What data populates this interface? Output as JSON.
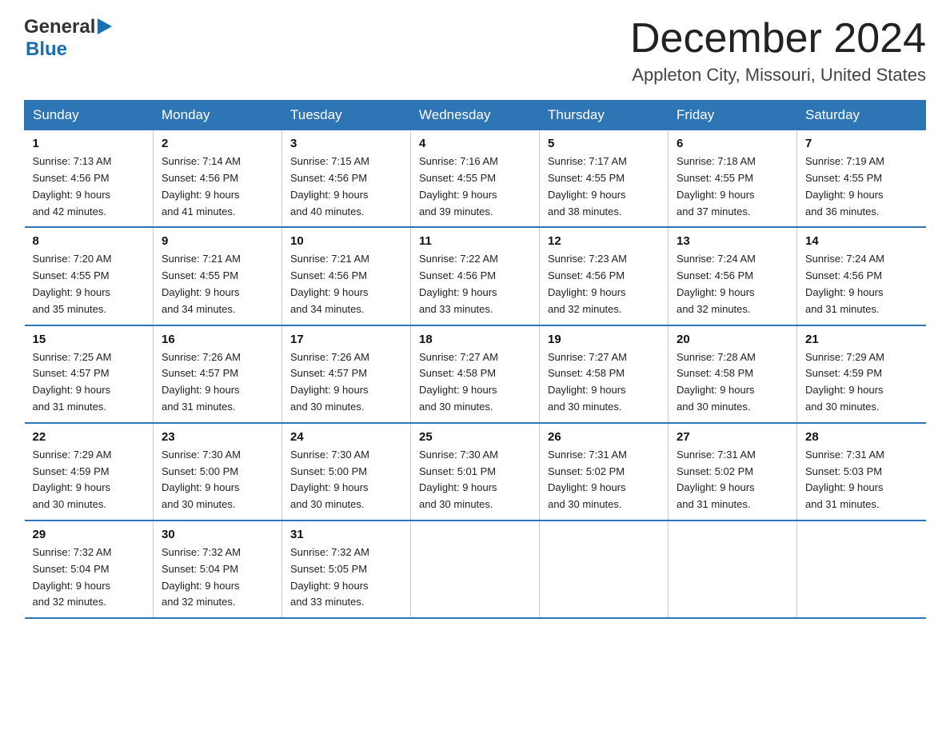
{
  "logo": {
    "text_general": "General",
    "text_blue": "Blue",
    "arrow": "▶"
  },
  "header": {
    "month": "December 2024",
    "location": "Appleton City, Missouri, United States"
  },
  "weekdays": [
    "Sunday",
    "Monday",
    "Tuesday",
    "Wednesday",
    "Thursday",
    "Friday",
    "Saturday"
  ],
  "weeks": [
    [
      {
        "day": "1",
        "sunrise": "7:13 AM",
        "sunset": "4:56 PM",
        "daylight": "9 hours and 42 minutes."
      },
      {
        "day": "2",
        "sunrise": "7:14 AM",
        "sunset": "4:56 PM",
        "daylight": "9 hours and 41 minutes."
      },
      {
        "day": "3",
        "sunrise": "7:15 AM",
        "sunset": "4:56 PM",
        "daylight": "9 hours and 40 minutes."
      },
      {
        "day": "4",
        "sunrise": "7:16 AM",
        "sunset": "4:55 PM",
        "daylight": "9 hours and 39 minutes."
      },
      {
        "day": "5",
        "sunrise": "7:17 AM",
        "sunset": "4:55 PM",
        "daylight": "9 hours and 38 minutes."
      },
      {
        "day": "6",
        "sunrise": "7:18 AM",
        "sunset": "4:55 PM",
        "daylight": "9 hours and 37 minutes."
      },
      {
        "day": "7",
        "sunrise": "7:19 AM",
        "sunset": "4:55 PM",
        "daylight": "9 hours and 36 minutes."
      }
    ],
    [
      {
        "day": "8",
        "sunrise": "7:20 AM",
        "sunset": "4:55 PM",
        "daylight": "9 hours and 35 minutes."
      },
      {
        "day": "9",
        "sunrise": "7:21 AM",
        "sunset": "4:55 PM",
        "daylight": "9 hours and 34 minutes."
      },
      {
        "day": "10",
        "sunrise": "7:21 AM",
        "sunset": "4:56 PM",
        "daylight": "9 hours and 34 minutes."
      },
      {
        "day": "11",
        "sunrise": "7:22 AM",
        "sunset": "4:56 PM",
        "daylight": "9 hours and 33 minutes."
      },
      {
        "day": "12",
        "sunrise": "7:23 AM",
        "sunset": "4:56 PM",
        "daylight": "9 hours and 32 minutes."
      },
      {
        "day": "13",
        "sunrise": "7:24 AM",
        "sunset": "4:56 PM",
        "daylight": "9 hours and 32 minutes."
      },
      {
        "day": "14",
        "sunrise": "7:24 AM",
        "sunset": "4:56 PM",
        "daylight": "9 hours and 31 minutes."
      }
    ],
    [
      {
        "day": "15",
        "sunrise": "7:25 AM",
        "sunset": "4:57 PM",
        "daylight": "9 hours and 31 minutes."
      },
      {
        "day": "16",
        "sunrise": "7:26 AM",
        "sunset": "4:57 PM",
        "daylight": "9 hours and 31 minutes."
      },
      {
        "day": "17",
        "sunrise": "7:26 AM",
        "sunset": "4:57 PM",
        "daylight": "9 hours and 30 minutes."
      },
      {
        "day": "18",
        "sunrise": "7:27 AM",
        "sunset": "4:58 PM",
        "daylight": "9 hours and 30 minutes."
      },
      {
        "day": "19",
        "sunrise": "7:27 AM",
        "sunset": "4:58 PM",
        "daylight": "9 hours and 30 minutes."
      },
      {
        "day": "20",
        "sunrise": "7:28 AM",
        "sunset": "4:58 PM",
        "daylight": "9 hours and 30 minutes."
      },
      {
        "day": "21",
        "sunrise": "7:29 AM",
        "sunset": "4:59 PM",
        "daylight": "9 hours and 30 minutes."
      }
    ],
    [
      {
        "day": "22",
        "sunrise": "7:29 AM",
        "sunset": "4:59 PM",
        "daylight": "9 hours and 30 minutes."
      },
      {
        "day": "23",
        "sunrise": "7:30 AM",
        "sunset": "5:00 PM",
        "daylight": "9 hours and 30 minutes."
      },
      {
        "day": "24",
        "sunrise": "7:30 AM",
        "sunset": "5:00 PM",
        "daylight": "9 hours and 30 minutes."
      },
      {
        "day": "25",
        "sunrise": "7:30 AM",
        "sunset": "5:01 PM",
        "daylight": "9 hours and 30 minutes."
      },
      {
        "day": "26",
        "sunrise": "7:31 AM",
        "sunset": "5:02 PM",
        "daylight": "9 hours and 30 minutes."
      },
      {
        "day": "27",
        "sunrise": "7:31 AM",
        "sunset": "5:02 PM",
        "daylight": "9 hours and 31 minutes."
      },
      {
        "day": "28",
        "sunrise": "7:31 AM",
        "sunset": "5:03 PM",
        "daylight": "9 hours and 31 minutes."
      }
    ],
    [
      {
        "day": "29",
        "sunrise": "7:32 AM",
        "sunset": "5:04 PM",
        "daylight": "9 hours and 32 minutes."
      },
      {
        "day": "30",
        "sunrise": "7:32 AM",
        "sunset": "5:04 PM",
        "daylight": "9 hours and 32 minutes."
      },
      {
        "day": "31",
        "sunrise": "7:32 AM",
        "sunset": "5:05 PM",
        "daylight": "9 hours and 33 minutes."
      },
      null,
      null,
      null,
      null
    ]
  ],
  "labels": {
    "sunrise": "Sunrise:",
    "sunset": "Sunset:",
    "daylight": "Daylight:"
  }
}
